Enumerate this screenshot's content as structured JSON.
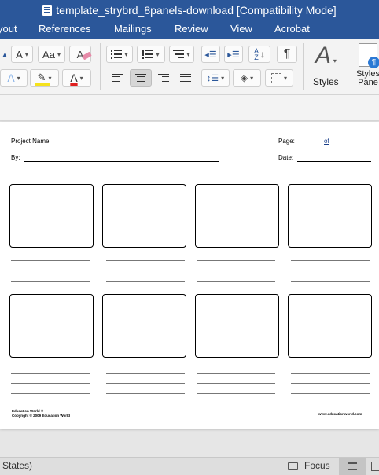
{
  "window": {
    "title": "template_strybrd_8panels-download [Compatibility Mode]",
    "doc_icon": "word-doc-icon"
  },
  "tabs": [
    "yout",
    "References",
    "Mailings",
    "Review",
    "View",
    "Acrobat"
  ],
  "ribbon": {
    "font_size_glyph": "A",
    "change_case_glyph": "Aa",
    "font_color_glyph": "A",
    "highlight_color": "#f5e21c",
    "font_color": "#e02020",
    "styles_label": "Styles",
    "styles_pane_label": "Styles Pane",
    "icons": [
      "grow-font-icon",
      "change-case-icon",
      "clear-formatting-icon",
      "bullets-icon",
      "numbering-icon",
      "multilevel-list-icon",
      "decrease-indent-icon",
      "increase-indent-icon",
      "sort-icon",
      "pilcrow-icon",
      "text-effects-icon",
      "highlight-icon",
      "font-color-icon",
      "align-left-icon",
      "align-center-icon",
      "align-right-icon",
      "justify-icon",
      "line-spacing-icon",
      "shading-icon",
      "borders-icon",
      "styles-icon",
      "styles-pane-icon"
    ]
  },
  "document": {
    "project_name_label": "Project Name:",
    "by_label": "By:",
    "page_label": "Page:",
    "of_label": "of",
    "date_label": "Date:",
    "panel_count": 8,
    "footer_left": "Education World ®\nCopyright © 2009 Education World",
    "footer_right": "www.educationworld.com"
  },
  "status": {
    "language": "States)",
    "focus_label": "Focus"
  }
}
